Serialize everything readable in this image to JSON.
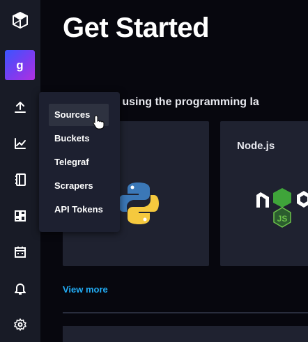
{
  "page": {
    "title": "Get Started",
    "subtitle": "query data using the programming la"
  },
  "sidebar": {
    "org_initial": "g",
    "icons": [
      "influx-logo-icon",
      "upload-icon",
      "graph-icon",
      "notebook-icon",
      "dashboard-icon",
      "calendar-icon",
      "bell-icon",
      "gear-icon"
    ]
  },
  "load_data_menu": {
    "items": [
      {
        "label": "Sources"
      },
      {
        "label": "Buckets"
      },
      {
        "label": "Telegraf"
      },
      {
        "label": "Scrapers"
      },
      {
        "label": "API Tokens"
      }
    ]
  },
  "cards": [
    {
      "label": ""
    },
    {
      "label": "Node.js"
    }
  ],
  "view_more": "View more",
  "colors": {
    "background": "#07070e",
    "sidebar": "#181b26",
    "card": "#1f2230",
    "link": "#22adf6",
    "menu": "#1d2030"
  }
}
